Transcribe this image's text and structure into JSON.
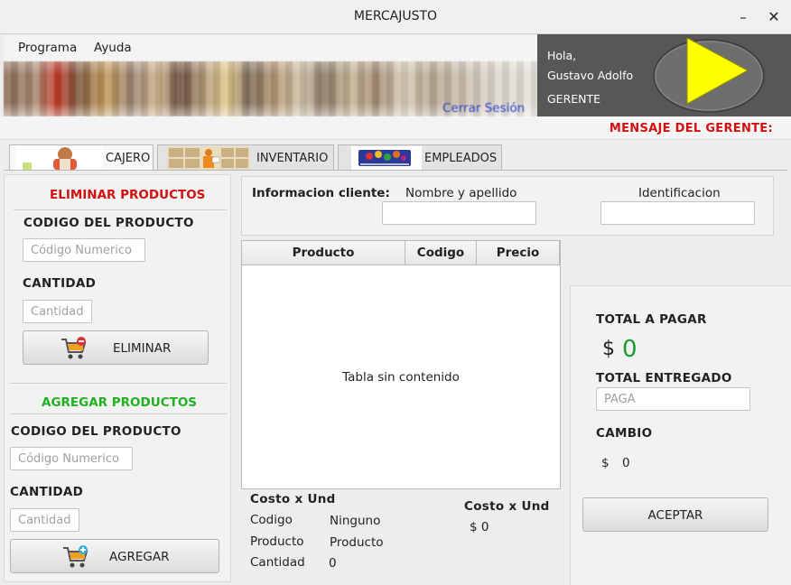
{
  "window": {
    "title": "MERCAJUSTO",
    "minimize_glyph": "–",
    "close_glyph": "✕"
  },
  "menu": {
    "items": [
      "Programa",
      "Ayuda"
    ]
  },
  "banner": {
    "logout_link": "Cerrar Sesión"
  },
  "user": {
    "greeting": "Hola,",
    "name": "Gustavo Adolfo",
    "role": "GERENTE",
    "avatar_icon": "play-triangle-icon"
  },
  "manager_message_label": "MENSAJE DEL GERENTE:",
  "tabs": [
    {
      "label": "CAJERO",
      "icon": "cashier-photo"
    },
    {
      "label": "INVENTARIO",
      "icon": "inventory-photo"
    },
    {
      "label": "EMPLEADOS",
      "icon": "shopping-cart-photo"
    }
  ],
  "remove_section": {
    "title": "ELIMINAR PRODUCTOS",
    "code_label": "CODIGO DEL PRODUCTO",
    "code_placeholder": "Código Numerico",
    "qty_label": "CANTIDAD",
    "qty_placeholder": "Cantidad",
    "button": "ELIMINAR"
  },
  "add_section": {
    "title": "AGREGAR PRODUCTOS",
    "code_label": "CODIGO DEL PRODUCTO",
    "code_placeholder": "Código Numerico",
    "qty_label": "CANTIDAD",
    "qty_placeholder": "Cantidad",
    "button": "AGREGAR"
  },
  "client": {
    "label": "Informacion cliente:",
    "name_label": "Nombre y apellido",
    "name_value": "",
    "id_label": "Identificacion",
    "id_value": ""
  },
  "table": {
    "columns": [
      "Producto",
      "Codigo",
      "Precio"
    ],
    "empty_message": "Tabla sin contenido"
  },
  "detail": {
    "title": "Costo x Und",
    "rows": [
      {
        "label": "Codigo",
        "value": "Ninguno"
      },
      {
        "label": "Producto",
        "value": "Producto"
      },
      {
        "label": "Cantidad",
        "value": "0"
      }
    ],
    "unit_cost_title": "Costo x Und",
    "unit_cost_value": "$ 0"
  },
  "payment": {
    "total_label": "TOTAL A PAGAR",
    "currency": "$",
    "total_value": "0",
    "delivered_label": "TOTAL ENTREGADO",
    "delivered_placeholder": "PAGA",
    "change_label": "CAMBIO",
    "change_currency": "$",
    "change_value": "0",
    "accept_button": "ACEPTAR"
  },
  "colors": {
    "accent_red": "#d11010",
    "accent_green": "#22b022",
    "total_green": "#1a9a2a",
    "link_blue": "#2b41c8",
    "user_panel_bg": "#575757",
    "avatar_yellow": "#ffff00"
  }
}
